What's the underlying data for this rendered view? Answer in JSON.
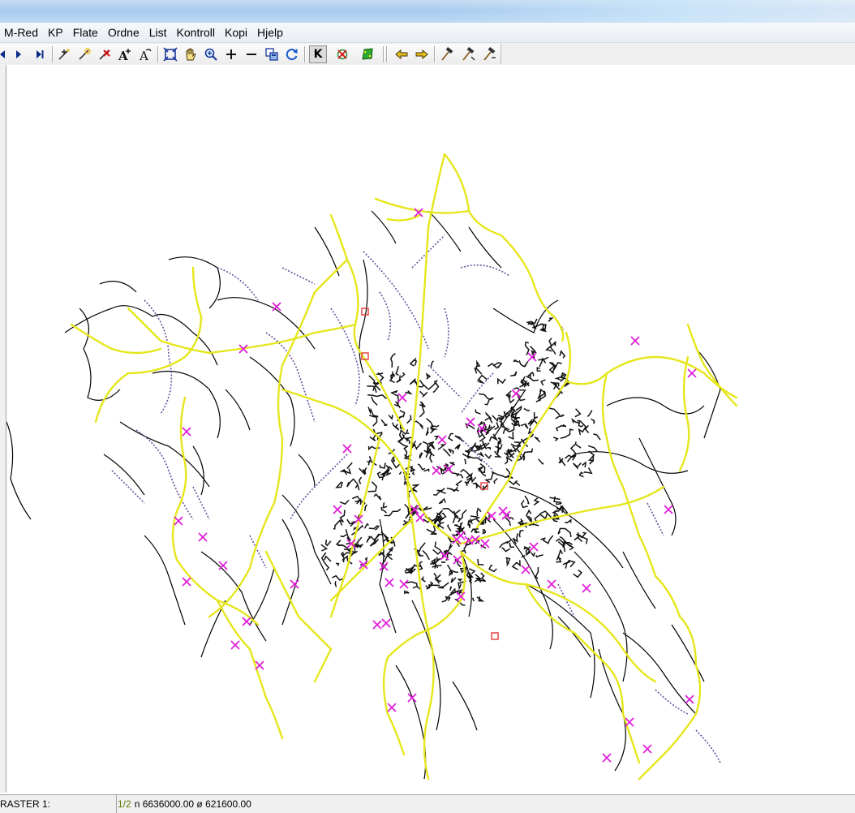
{
  "menu": [
    "M-Red",
    "KP",
    "Flate",
    "Ordne",
    "List",
    "Kontroll",
    "Kopi",
    "Hjelp"
  ],
  "toolbar": {
    "groups": [
      [
        "first-icon",
        "next-icon",
        "last-icon"
      ],
      [
        "add-point-icon",
        "edit-point-icon",
        "delete-point-icon",
        "text-add-icon",
        "text-edit-icon"
      ],
      [
        "zoom-extent-icon",
        "pan-icon",
        "zoom-in-icon",
        "plus-icon",
        "minus-icon",
        "copy-view-icon",
        "refresh-icon"
      ],
      [
        "k-icon",
        "target-icon",
        "polygon-fill-icon"
      ],
      [
        "arrow-left-icon",
        "arrow-right-icon",
        "hammer-icon",
        "hammer2-icon",
        "hammer3-icon"
      ]
    ],
    "k_label": "K"
  },
  "colors": {
    "road_major": "#e6e61c",
    "road_minor": "#000000",
    "path": "#6a4f9a",
    "marker": "#e01ed8",
    "box": "#e03a3a"
  },
  "map": {
    "description_layers": [
      "major-roads",
      "minor-roads",
      "paths",
      "markers"
    ]
  },
  "status": {
    "raster_label": "RASTER 1:",
    "count": "1/2",
    "coords": "n 6636000.00  ø 621600.00"
  }
}
